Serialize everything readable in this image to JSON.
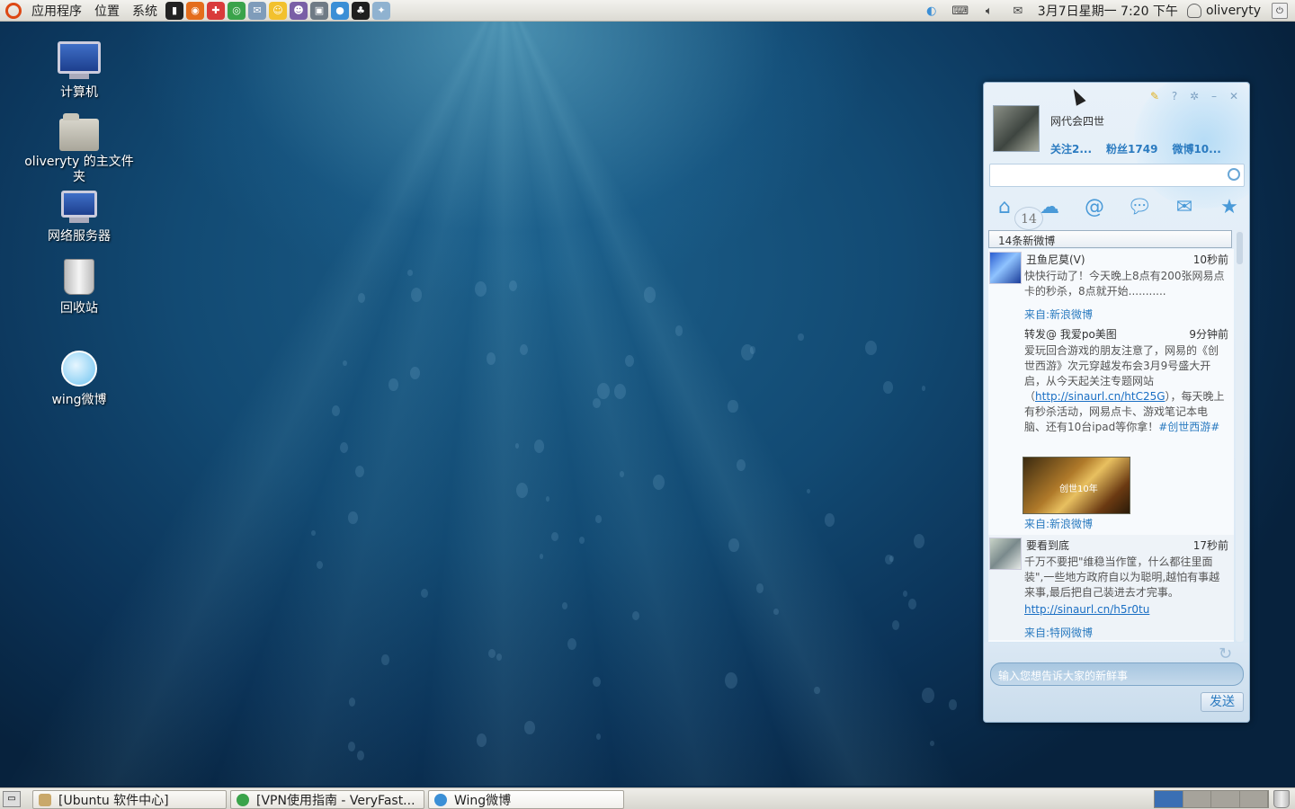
{
  "top_panel": {
    "menus": [
      "应用程序",
      "位置",
      "系统"
    ],
    "launchers": [
      {
        "name": "terminal-icon",
        "glyph": "▮",
        "color": "#222222"
      },
      {
        "name": "firefox-icon",
        "glyph": "◉",
        "color": "#e46d1c"
      },
      {
        "name": "help-icon",
        "glyph": "✚",
        "color": "#d93b3b"
      },
      {
        "name": "chrome-icon",
        "glyph": "◎",
        "color": "#3aa34a"
      },
      {
        "name": "mail-icon",
        "glyph": "✉",
        "color": "#7f9cba"
      },
      {
        "name": "pidgin-icon",
        "glyph": "☺",
        "color": "#f2c12e"
      },
      {
        "name": "chat-icon",
        "glyph": "☻",
        "color": "#7a5fa6"
      },
      {
        "name": "screenshot-icon",
        "glyph": "▣",
        "color": "#6f7a85"
      },
      {
        "name": "messenger-icon",
        "glyph": "●",
        "color": "#3b8fd6"
      },
      {
        "name": "qq-icon",
        "glyph": "♣",
        "color": "#1f1f1f"
      },
      {
        "name": "settings-applet-icon",
        "glyph": "✦",
        "color": "#8fb2d0"
      }
    ],
    "clock": "3月7日星期一  7:20 下午",
    "username": "oliveryty"
  },
  "desktop_icons": [
    {
      "name": "computer",
      "label": "计算机"
    },
    {
      "name": "home-folder",
      "label": "oliveryty 的主文件夹"
    },
    {
      "name": "network-servers",
      "label": "网络服务器"
    },
    {
      "name": "trash",
      "label": "回收站"
    },
    {
      "name": "wing-weibo",
      "label": "wing微博"
    }
  ],
  "wing": {
    "profile_name": "网代会四世",
    "stats": {
      "follow": "关注2...",
      "fans": "粉丝1749",
      "weibo": "微博10..."
    },
    "search_placeholder": "",
    "nav_badge": "14",
    "new_count_label": "14条新微博",
    "posts": [
      {
        "author": "丑鱼尼莫(V)",
        "time": "10秒前",
        "text": "快快行动了！今天晚上8点有200张网易点卡的秒杀，8点就开始...........",
        "source": "来自:新浪微博",
        "repost": {
          "author_prefix": "转发@",
          "author": "我爱po美图",
          "time": "9分钟前",
          "text_before": "爱玩回合游戏的朋友注意了，网易的《创世西游》次元穿越发布会3月9号盛大开启，从今天起关注专题网站（",
          "link": "http://sinaurl.cn/htC25G",
          "text_after": "），每天晚上有秒杀活动，网易点卡、游戏笔记本电脑、还有10台ipad等你拿！",
          "tag": "#创世西游#",
          "image_caption": "创世10年",
          "source": "来自:新浪微博"
        }
      },
      {
        "author": "要看到底",
        "time": "17秒前",
        "text": "千万不要把\"维稳当作筐，什么都往里面装\",一些地方政府自以为聪明,越怕有事越来事,最后把自己装进去才完事。",
        "link": "http://sinaurl.cn/h5r0tu",
        "source": "来自:特网微博"
      }
    ],
    "compose_placeholder": "输入您想告诉大家的新鲜事",
    "send_label": "发送"
  },
  "taskbar": {
    "tasks": [
      {
        "label": "[Ubuntu 软件中心]",
        "color": "#c9a86a"
      },
      {
        "label": "[VPN使用指南 - VeryFast...",
        "color": "#3aa34a"
      },
      {
        "label": "Wing微博",
        "color": "#3b8fd6"
      }
    ],
    "workspaces": 4,
    "active_workspace": 1
  }
}
